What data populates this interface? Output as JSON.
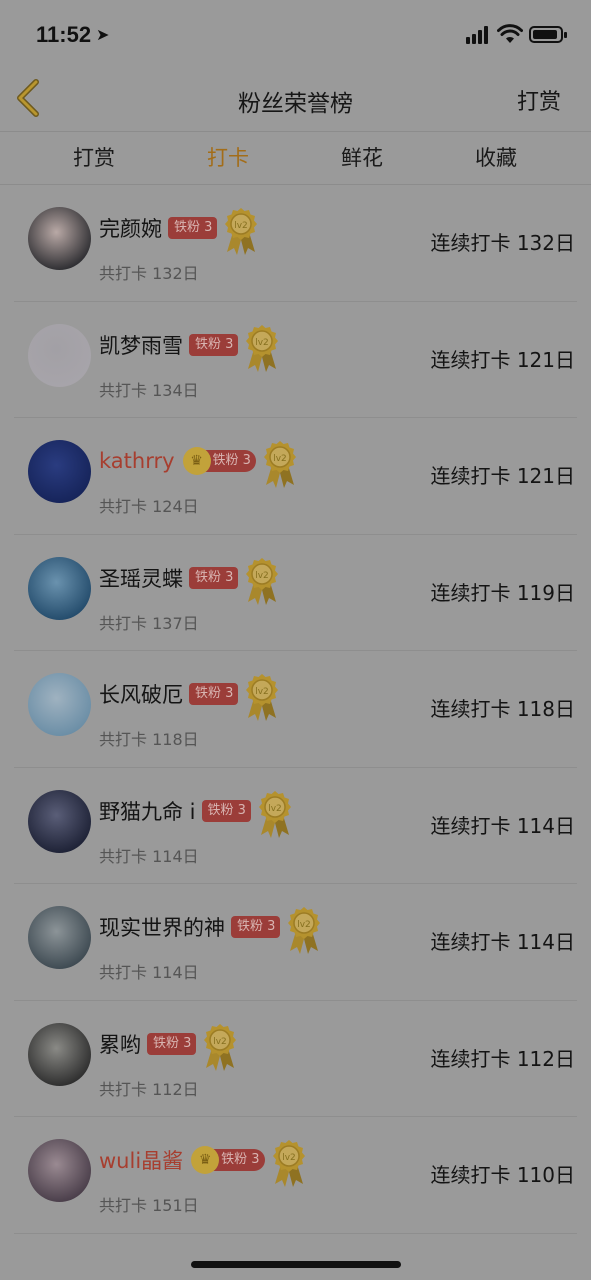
{
  "status": {
    "time": "11:52"
  },
  "nav": {
    "title": "粉丝荣誉榜",
    "right_label": "打赏"
  },
  "tabs": [
    {
      "label": "打赏",
      "active": false
    },
    {
      "label": "打卡",
      "active": true
    },
    {
      "label": "鲜花",
      "active": false
    },
    {
      "label": "收藏",
      "active": false
    }
  ],
  "colors": {
    "accent": "#a36d19",
    "highlight_name": "#a73e2f",
    "badge_bg": "#9b3d39",
    "overlay_bg": "#9a9a9a"
  },
  "entries": [
    {
      "name": "完颜婉",
      "badge": "铁粉 3",
      "level": "lv2",
      "total": "共打卡 132日",
      "streak": "连续打卡 132日",
      "crown": false,
      "red": false,
      "avatar": [
        "#2e2e32",
        "#b9a9a6"
      ]
    },
    {
      "name": "凯梦雨雪",
      "badge": "铁粉 3",
      "level": "lv2",
      "total": "共打卡 134日",
      "streak": "连续打卡 121日",
      "crown": false,
      "red": false,
      "avatar": [
        "#a7a4aa",
        "#a2a0a5"
      ]
    },
    {
      "name": "kathrry",
      "badge": "铁粉 3",
      "level": "lv2",
      "total": "共打卡 124日",
      "streak": "连续打卡 121日",
      "crown": true,
      "red": true,
      "avatar": [
        "#16245a",
        "#2a3c80"
      ]
    },
    {
      "name": "圣瑶灵蝶",
      "badge": "铁粉 3",
      "level": "lv2",
      "total": "共打卡 137日",
      "streak": "连续打卡 119日",
      "crown": false,
      "red": false,
      "avatar": [
        "#244c6c",
        "#6a92ae"
      ]
    },
    {
      "name": "长风破厄",
      "badge": "铁粉 3",
      "level": "lv2",
      "total": "共打卡 118日",
      "streak": "连续打卡 118日",
      "crown": false,
      "red": false,
      "avatar": [
        "#6b8ea6",
        "#9fb2c0"
      ]
    },
    {
      "name": "野猫九命 i",
      "badge": "铁粉 3",
      "level": "lv2",
      "total": "共打卡 114日",
      "streak": "连续打卡 114日",
      "crown": false,
      "red": false,
      "avatar": [
        "#1e2236",
        "#5a5e78"
      ]
    },
    {
      "name": "现实世界的神",
      "badge": "铁粉 3",
      "level": "lv2",
      "total": "共打卡 114日",
      "streak": "连续打卡 114日",
      "crown": false,
      "red": false,
      "avatar": [
        "#3e4a52",
        "#8c9498"
      ]
    },
    {
      "name": "累哟",
      "badge": "铁粉 3",
      "level": "lv2",
      "total": "共打卡 112日",
      "streak": "连续打卡 112日",
      "crown": false,
      "red": false,
      "avatar": [
        "#2e2e2e",
        "#8a8a86"
      ]
    },
    {
      "name": "wuli晶酱",
      "badge": "铁粉 3",
      "level": "lv2",
      "total": "共打卡 151日",
      "streak": "连续打卡 110日",
      "crown": true,
      "red": true,
      "avatar": [
        "#4a3e4a",
        "#9a8a92"
      ]
    }
  ]
}
